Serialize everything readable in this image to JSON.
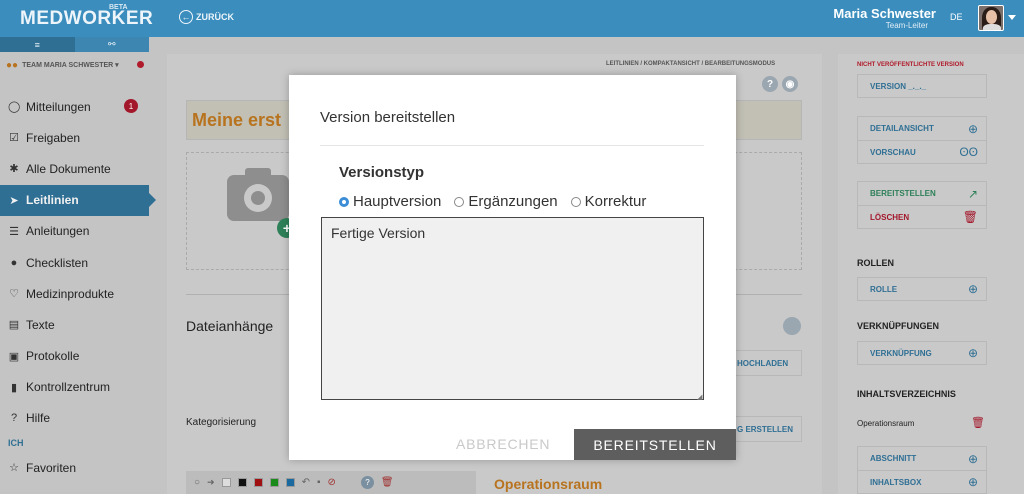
{
  "header": {
    "logo": "MEDWORKER",
    "beta": "BETA",
    "back_label": "ZURÜCK",
    "user_name": "Maria Schwester",
    "user_role": "Team-Leiter",
    "lang": "DE"
  },
  "sidebar": {
    "tabs": [
      "≡",
      "⚯"
    ],
    "team_label": "TEAM MARIA SCHWESTER ▾",
    "items": [
      {
        "label": "Mitteilungen",
        "icon": "chat-icon",
        "glyph": "◯",
        "badge": "1"
      },
      {
        "label": "Freigaben",
        "icon": "check-square-icon",
        "glyph": "☑"
      },
      {
        "label": "Alle Dokumente",
        "icon": "asterisk-icon",
        "glyph": "✱"
      },
      {
        "label": "Leitlinien",
        "icon": "paper-plane-icon",
        "glyph": "➤",
        "active": true
      },
      {
        "label": "Anleitungen",
        "icon": "list-icon",
        "glyph": "☰"
      },
      {
        "label": "Checklisten",
        "icon": "check-circle-icon",
        "glyph": "●"
      },
      {
        "label": "Medizinprodukte",
        "icon": "heartbeat-icon",
        "glyph": "♡"
      },
      {
        "label": "Texte",
        "icon": "newspaper-icon",
        "glyph": "▤"
      },
      {
        "label": "Protokolle",
        "icon": "clipboard-icon",
        "glyph": "▣"
      },
      {
        "label": "Kontrollzentrum",
        "icon": "bar-chart-icon",
        "glyph": "▮"
      },
      {
        "label": "Hilfe",
        "icon": "question-circle-icon",
        "glyph": "?"
      }
    ],
    "section_ich": "ICH",
    "favoriten": {
      "label": "Favoriten",
      "icon": "star-icon",
      "glyph": "☆"
    }
  },
  "main": {
    "breadcrumb": "LEITLINIEN / KOMPAKTANSICHT / BEARBEITUNGSMODUS",
    "title": "Meine erst",
    "attachments_heading": "Dateianhänge",
    "upload_button": "HOCHLADEN",
    "categorization_label": "Kategorisierung",
    "create_button": "G ERSTELLEN",
    "section_title": "Operationsraum"
  },
  "right_panel": {
    "unpublished_label": "NICHT VERÖFFENTLICHTE VERSION",
    "version_label": "VERSION _._._",
    "detail_label": "DETAILANSICHT",
    "preview_label": "VORSCHAU",
    "deploy_label": "BEREITSTELLEN",
    "delete_label": "LÖSCHEN",
    "roles_heading": "ROLLEN",
    "role_button": "ROLLE",
    "links_heading": "VERKNÜPFUNGEN",
    "link_button": "VERKNÜPFUNG",
    "toc_heading": "INHALTSVERZEICHNIS",
    "toc_item": "Operationsraum",
    "section_button": "ABSCHNITT",
    "contentbox_button": "INHALTSBOX"
  },
  "modal": {
    "title": "Version bereitstellen",
    "version_type_label": "Versionstyp",
    "options": [
      {
        "label": "Hauptversion",
        "selected": true
      },
      {
        "label": "Ergänzungen",
        "selected": false
      },
      {
        "label": "Korrektur",
        "selected": false
      }
    ],
    "textarea_value": "Fertige Version",
    "cancel_label": "ABBRECHEN",
    "submit_label": "BEREITSTELLEN"
  },
  "colors": {
    "header_blue": "#3a8dbd",
    "active_nav": "#2f6f94",
    "badge_red": "#a3172a",
    "title_orange": "#b8731f",
    "radio_blue": "#3a8dd6",
    "submit_gray": "#5e5e5e"
  }
}
